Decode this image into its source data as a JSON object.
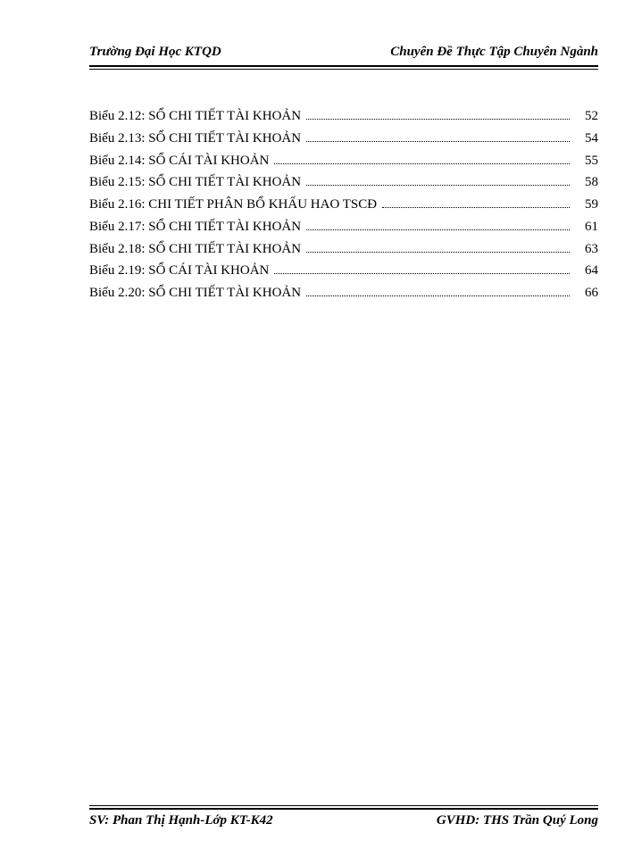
{
  "header": {
    "left": "Trường Đại Học KTQD",
    "right": "Chuyên Đề Thực Tập Chuyên Ngành"
  },
  "toc": {
    "entries": [
      {
        "label": "Biểu 2.12: SỔ CHI TIẾT TÀI KHOẢN",
        "page": "52"
      },
      {
        "label": "Biểu 2.13: SỔ CHI TIẾT TÀI KHOẢN",
        "page": "54"
      },
      {
        "label": "Biểu 2.14: SỔ CÁI TÀI KHOẢN",
        "page": "55"
      },
      {
        "label": "Biểu 2.15: SỔ CHI TIẾT TÀI KHOẢN",
        "page": "58"
      },
      {
        "label": "Biểu 2.16: CHI TIẾT PHÂN BỔ KHẤU HAO TSCĐ",
        "page": "59"
      },
      {
        "label": "Biểu 2.17: SỔ CHI TIẾT TÀI KHOẢN",
        "page": "61"
      },
      {
        "label": "Biểu 2.18: SỔ CHI TIẾT TÀI KHOẢN",
        "page": "63"
      },
      {
        "label": "Biểu 2.19: SỔ CÁI TÀI KHOẢN",
        "page": "64"
      },
      {
        "label": "Biểu 2.20: SỔ CHI TIẾT TÀI KHOẢN",
        "page": "66"
      }
    ]
  },
  "footer": {
    "left": "SV: Phan Thị Hạnh-Lớp KT-K42",
    "right": "GVHD: THS Trần Quý Long"
  }
}
